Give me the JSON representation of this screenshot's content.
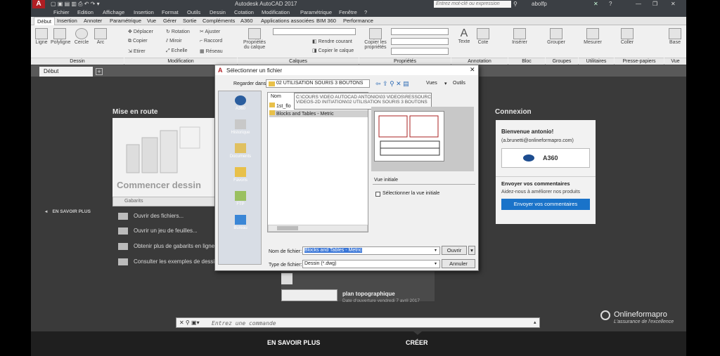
{
  "app": {
    "logo": "A",
    "title": "Autodesk AutoCAD 2017",
    "search_placeholder": "Entrez mot-clé ou expression",
    "user": "abolfp",
    "help": "?"
  },
  "menubar": [
    "Fichier",
    "Edition",
    "Affichage",
    "Insertion",
    "Format",
    "Outils",
    "Dessin",
    "Cotation",
    "Modification",
    "Paramétrique",
    "Fenêtre",
    "?"
  ],
  "ribbon_tabs": [
    "Début",
    "Insertion",
    "Annoter",
    "Paramétrique",
    "Vue",
    "Gérer",
    "Sortie",
    "Compléments",
    "A360",
    "Applications associées",
    "BIM 360",
    "Performance"
  ],
  "ribbon": {
    "dessin": {
      "group": "Dessin",
      "tools": [
        "Ligne",
        "Polyligne",
        "Cercle",
        "Arc"
      ]
    },
    "modification": {
      "group": "Modification",
      "tools": [
        "Déplacer",
        "Rotation",
        "Ajuster",
        "Copier",
        "Miroir",
        "Raccord",
        "Etirer",
        "Echelle",
        "Réseau"
      ]
    },
    "calques": {
      "group": "Calques",
      "tools": [
        "Propriétés du calque",
        "Rendre courant",
        "Copier le calque"
      ]
    },
    "proprietes": {
      "group": "Propriétés",
      "tools": [
        "Copier les propriétés"
      ]
    },
    "annotation": {
      "group": "Annotation",
      "tools": [
        "Texte",
        "Cote"
      ]
    },
    "bloc": {
      "group": "Bloc",
      "tools": [
        "Insérer"
      ]
    },
    "groupes": {
      "group": "Groupes",
      "tools": [
        "Grouper"
      ]
    },
    "utilitaires": {
      "group": "Utilitaires",
      "tools": [
        "Mesurer"
      ]
    },
    "presse": {
      "group": "Presse-papiers",
      "tools": [
        "Coller"
      ]
    },
    "vue": {
      "group": "Vue",
      "tools": [
        "Base"
      ]
    }
  },
  "doc_tab": "Début",
  "startpage": {
    "mise_en_route": "Mise en route",
    "commencer": "Commencer dessin",
    "gabarits": "Gabarits",
    "en_savoir_plus_side": "EN SAVOIR PLUS",
    "links": [
      "Ouvrir des fichiers...",
      "Ouvrir un jeu de feuilles...",
      "Obtenir plus de gabarits en ligne",
      "Consulter les exemples de dessins..."
    ],
    "recent_name": "plan topographique",
    "recent_date": "Date d'ouverture vendredi 7 avril 2017",
    "connexion": "Connexion",
    "bienvenue": "Bienvenue antonio!",
    "email": "(a.brunetti@onlineformapro.com)",
    "a360": "A360",
    "envoyer_titre": "Envoyer vos commentaires",
    "envoyer_texte": "Aidez-nous à améliorer nos produits",
    "envoyer_btn": "Envoyer vos commentaires"
  },
  "dialog": {
    "title": "Sélectionner un fichier",
    "regarder_label": "Regarder dans:",
    "folder": "02 UTILISATION SOURIS 3 BOUTONS",
    "vues": "Vues",
    "outils": "Outils",
    "places": [
      "A360",
      "Historique",
      "Documents",
      "Favoris",
      "FTP",
      "Bureau"
    ],
    "col_nom": "Nom",
    "files": [
      "1st_flo",
      "Blocks and Tables - Metric"
    ],
    "tooltip_line1": "C:\\COURS VIDEO AUTOCAD ANTONIO\\03 VIDEOS\\RESSOURCES",
    "tooltip_line2": "VIDEOS-2D INITIATION\\02 UTILISATION SOURIS 3 BOUTONS",
    "apercu": "Aperçu",
    "vue_initiale": "Vue initiale",
    "selectionner_vue": "Sélectionner la vue initiale",
    "nom_label": "Nom de fichier:",
    "nom_value": "Blocks and Tables - Metric",
    "type_label": "Type de fichier:",
    "type_value": "Dessin (*.dwg)",
    "ouvrir": "Ouvrir",
    "annuler": "Annuler"
  },
  "commandline": {
    "placeholder": "Entrez une commande"
  },
  "brand": {
    "name": "Onlineformapro",
    "tagline": "L'assurance de l'excellence"
  },
  "bottom": {
    "left": "EN SAVOIR PLUS",
    "right": "CRÉER"
  },
  "colors": {
    "accent_red": "#b01e23",
    "button_blue": "#1a73c9",
    "selection_blue": "#3875d7"
  }
}
